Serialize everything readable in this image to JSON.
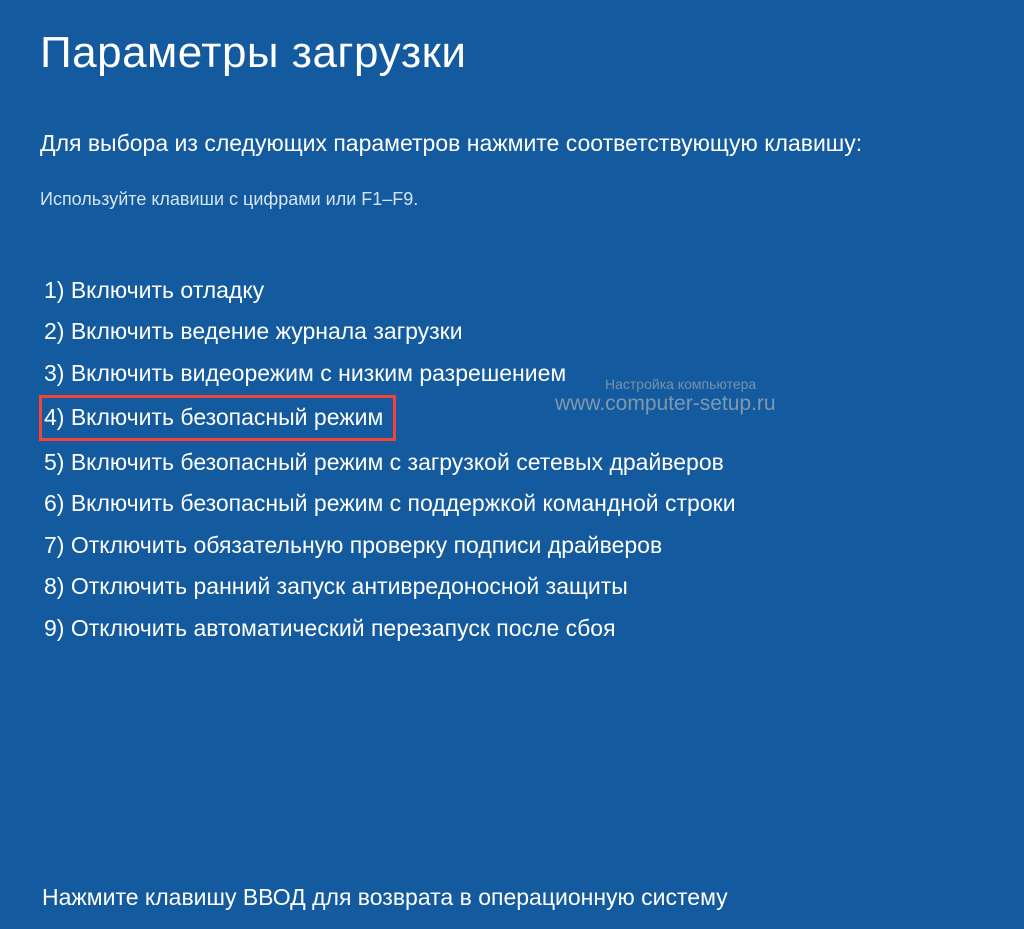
{
  "title": "Параметры загрузки",
  "instruction": "Для выбора из следующих параметров нажмите соответствующую клавишу:",
  "hint": "Используйте клавиши с цифрами или F1–F9.",
  "options": [
    {
      "label": "1) Включить отладку",
      "highlighted": false
    },
    {
      "label": "2) Включить ведение журнала загрузки",
      "highlighted": false
    },
    {
      "label": "3) Включить видеорежим с низким разрешением",
      "highlighted": false
    },
    {
      "label": "4) Включить безопасный режим",
      "highlighted": true
    },
    {
      "label": "5) Включить безопасный режим с загрузкой сетевых драйверов",
      "highlighted": false
    },
    {
      "label": "6) Включить безопасный режим с поддержкой командной строки",
      "highlighted": false
    },
    {
      "label": "7) Отключить обязательную проверку подписи драйверов",
      "highlighted": false
    },
    {
      "label": "8) Отключить ранний запуск антивредоносной защиты",
      "highlighted": false
    },
    {
      "label": "9) Отключить автоматический перезапуск после сбоя",
      "highlighted": false
    }
  ],
  "footer": "Нажмите клавишу ВВОД для возврата в операционную систему",
  "watermark": {
    "line1": "Настройка компьютера",
    "line2": "www.computer-setup.ru"
  },
  "colors": {
    "background": "#145a9e",
    "text": "#ffffff",
    "highlight_border": "#f44336",
    "watermark": "#8a9fb3"
  }
}
